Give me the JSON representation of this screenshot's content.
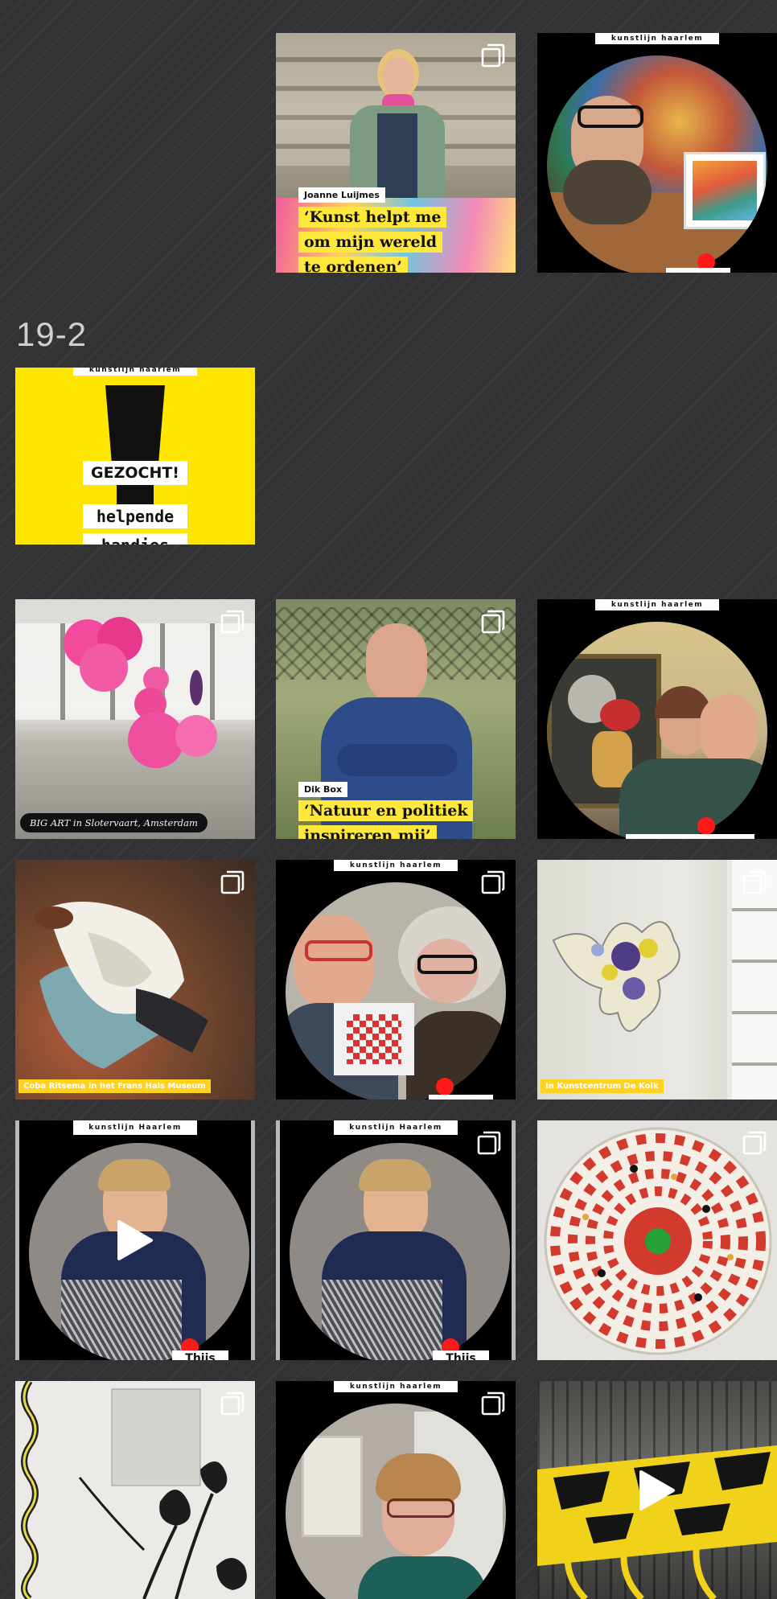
{
  "section": {
    "date_label": "19-2"
  },
  "posts": {
    "p1": {
      "name_tag": "Joanne Luijmes",
      "quote_lines": [
        "‘Kunst helpt me",
        "om mijn wereld",
        "te ordenen’"
      ],
      "icon": "multiple-photos-icon"
    },
    "p2": {
      "banner": "kunstlijn haarlem",
      "icon": "none"
    },
    "p3": {
      "banner": "kunstlijn haarlem",
      "headline": "GEZOCHT!",
      "subline_1": "helpende",
      "subline_2": "handjes"
    },
    "p4": {
      "caption": "BIG ART in Slotervaart, Amsterdam",
      "icon": "multiple-photos-icon"
    },
    "p5": {
      "name_tag": "Dik Box",
      "quote_lines": [
        "‘Natuur en politiek",
        "inspireren mij’"
      ],
      "icon": "multiple-photos-icon"
    },
    "p6": {
      "banner": "kunstlijn haarlem"
    },
    "p7": {
      "caption": "Coba Ritsema in het Frans Hals Museum",
      "icon": "multiple-photos-icon"
    },
    "p8": {
      "banner": "kunstlijn haarlem",
      "icon": "multiple-photos-icon"
    },
    "p9": {
      "caption": "In Kunstcentrum De Kolk",
      "icon": "multiple-photos-icon"
    },
    "p10": {
      "banner": "kunstlijn Haarlem",
      "bottom_text": "Thijs",
      "icon": "play-icon"
    },
    "p11": {
      "banner": "kunstlijn Haarlem",
      "bottom_text": "Thijs",
      "icon": "multiple-photos-icon"
    },
    "p12": {
      "icon": "multiple-photos-icon"
    },
    "p13": {
      "icon": "multiple-photos-icon"
    },
    "p14": {
      "banner": "kunstlijn haarlem",
      "icon": "multiple-photos-icon"
    },
    "p15": {
      "icon": "play-icon"
    }
  },
  "colors": {
    "page_background": "#333335",
    "accent_yellow": "#ffe73b",
    "poster_yellow": "#ffe600",
    "recording_dot": "#ff1a1a"
  }
}
